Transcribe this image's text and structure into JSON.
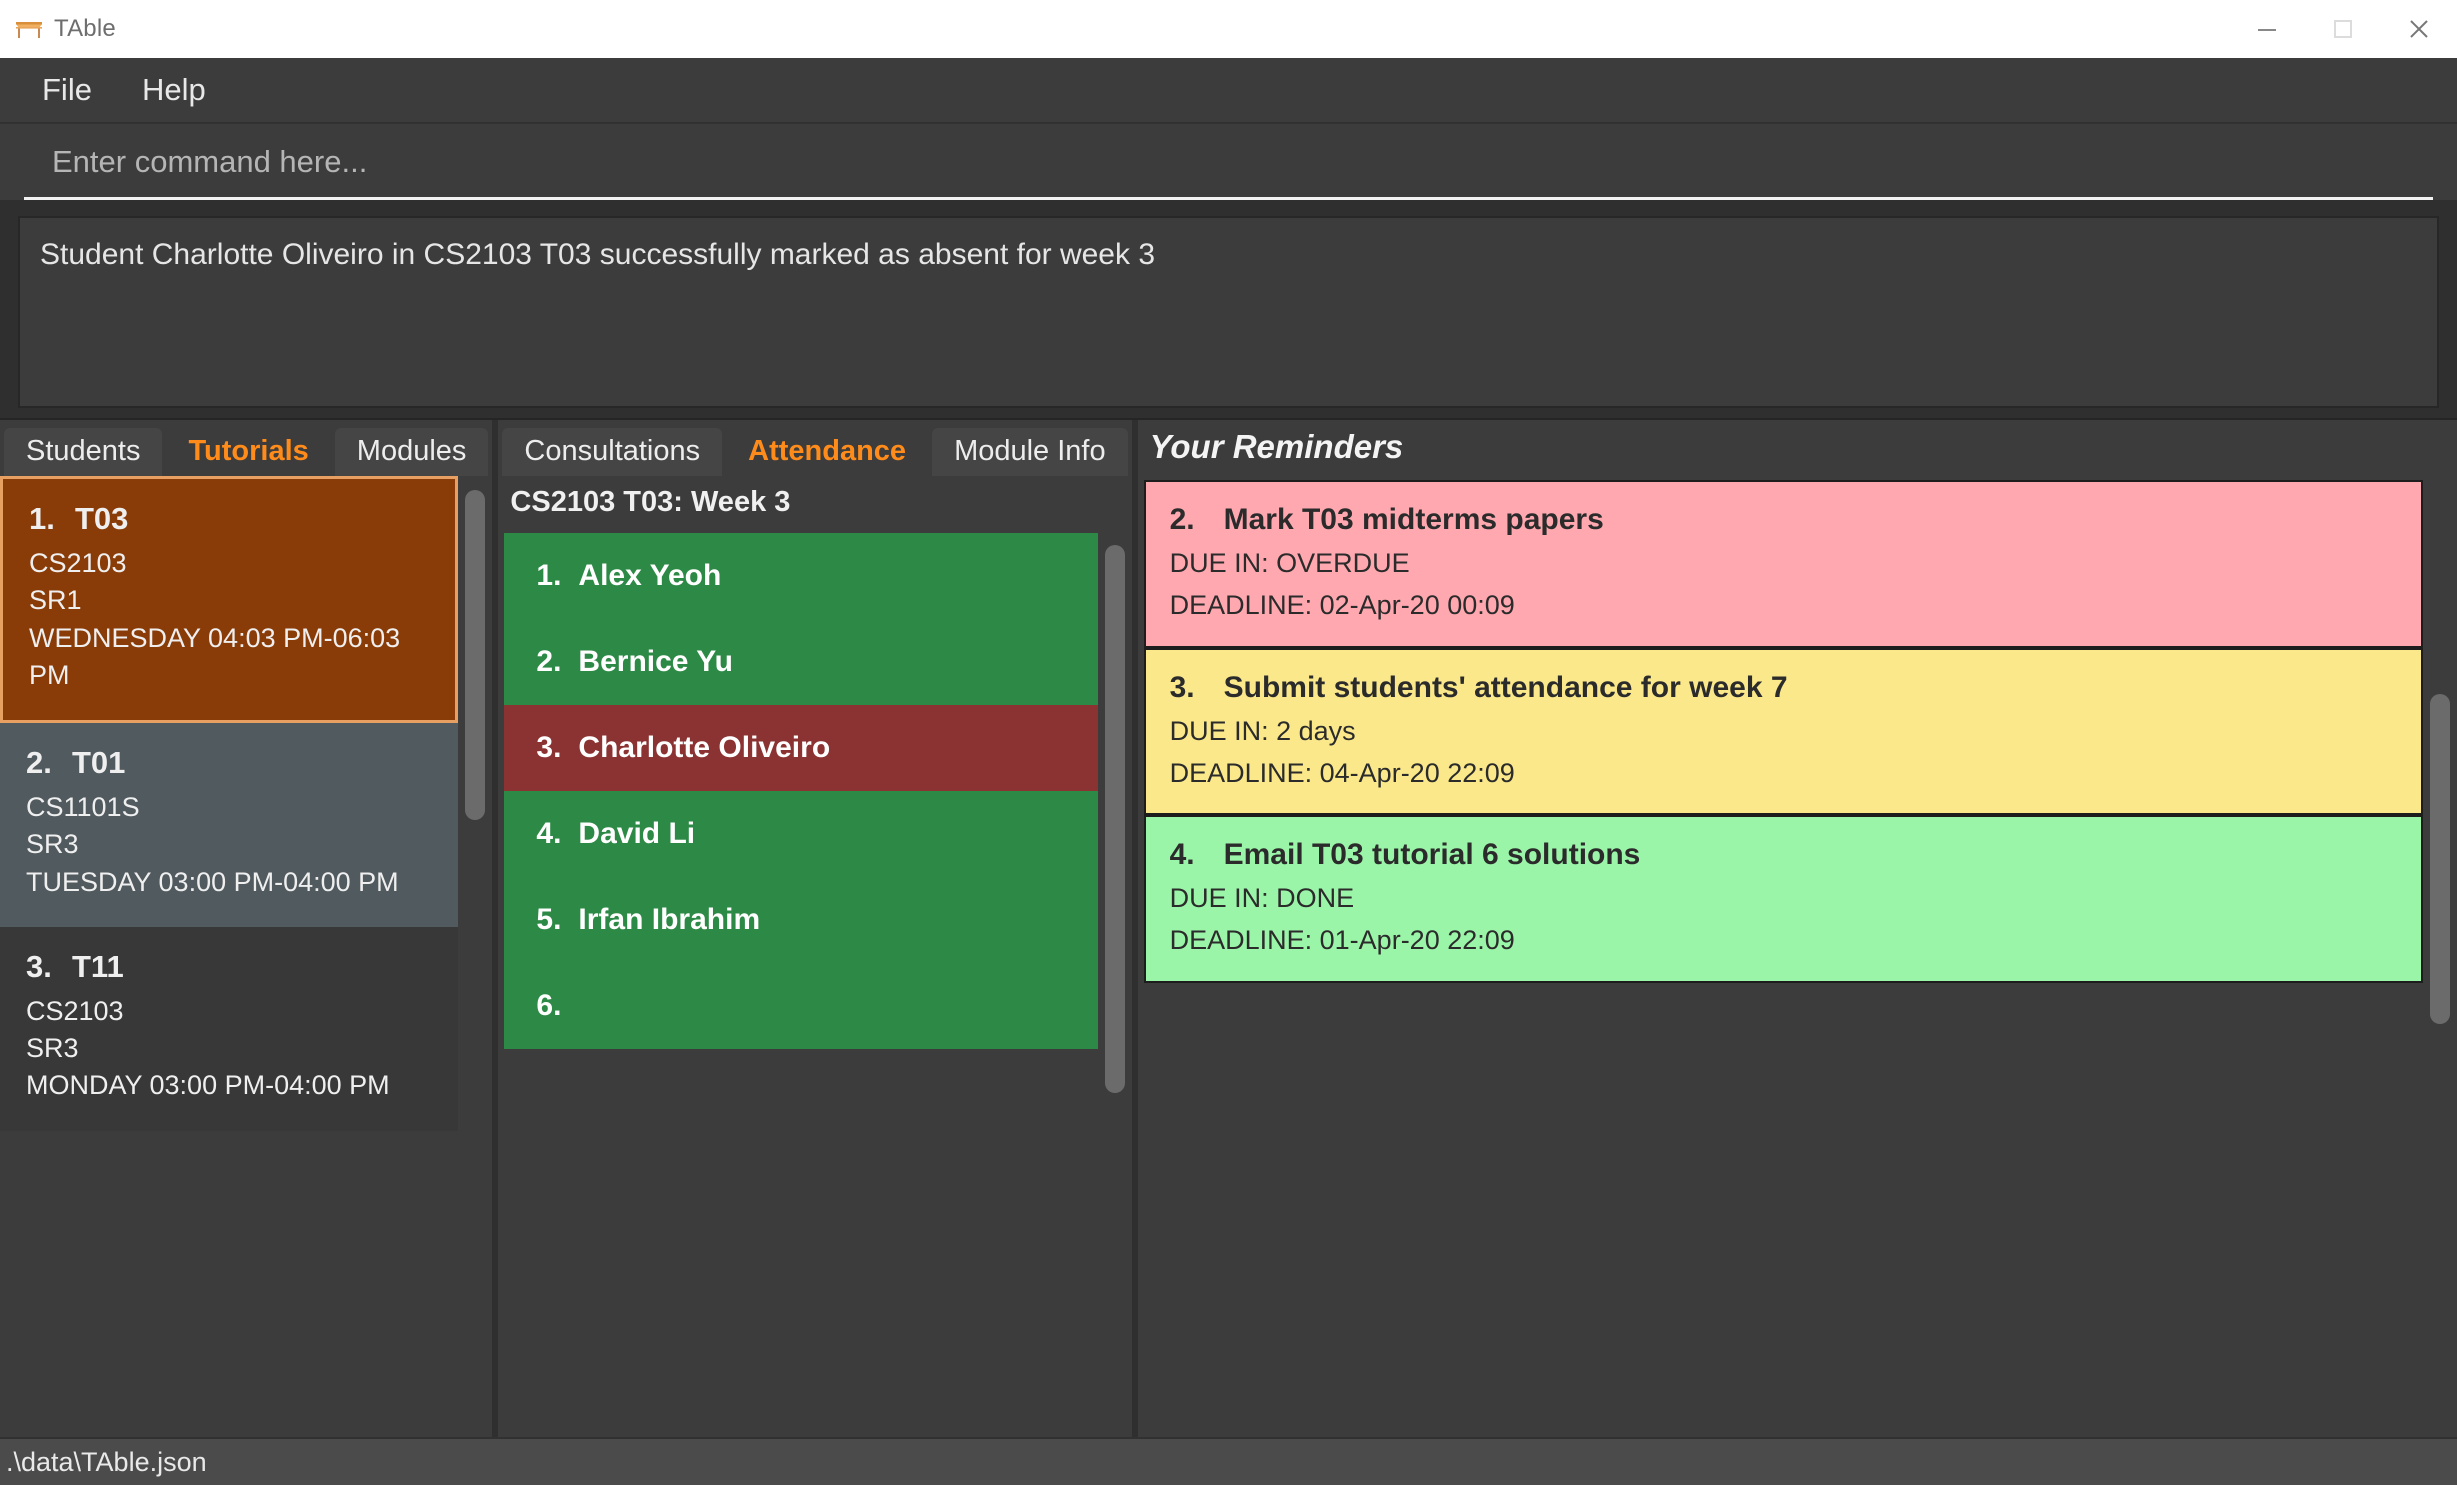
{
  "window": {
    "title": "TAble",
    "icon": "table-icon",
    "minimize_label": "—",
    "maximize_label": "□",
    "close_label": "✕"
  },
  "menubar": {
    "items": [
      {
        "label": "File"
      },
      {
        "label": "Help"
      }
    ]
  },
  "command": {
    "placeholder": "Enter command here...",
    "value": ""
  },
  "result": {
    "text": "Student Charlotte Oliveiro in CS2103 T03 successfully marked as absent for week 3"
  },
  "left_panel": {
    "tabs": [
      {
        "label": "Students",
        "active": false
      },
      {
        "label": "Tutorials",
        "active": true
      },
      {
        "label": "Modules",
        "active": false
      }
    ],
    "tutorials": [
      {
        "index": "1.",
        "name": "T03",
        "module": "CS2103",
        "venue": "SR1",
        "time": "WEDNESDAY 04:03 PM-06:03 PM",
        "state": "selected"
      },
      {
        "index": "2.",
        "name": "T01",
        "module": "CS1101S",
        "venue": "SR3",
        "time": "TUESDAY 03:00 PM-04:00 PM",
        "state": "alt"
      },
      {
        "index": "3.",
        "name": "T11",
        "module": "CS2103",
        "venue": "SR3",
        "time": "MONDAY 03:00 PM-04:00 PM",
        "state": "plain"
      }
    ]
  },
  "mid_panel": {
    "tabs": [
      {
        "label": "Consultations",
        "active": false
      },
      {
        "label": "Attendance",
        "active": true
      },
      {
        "label": "Module Info",
        "active": false
      }
    ],
    "attendance_title": "CS2103 T03: Week 3",
    "students": [
      {
        "index": "1.",
        "name": "Alex Yeoh",
        "status": "present"
      },
      {
        "index": "2.",
        "name": "Bernice Yu",
        "status": "present"
      },
      {
        "index": "3.",
        "name": "Charlotte Oliveiro",
        "status": "absent"
      },
      {
        "index": "4.",
        "name": "David Li",
        "status": "present"
      },
      {
        "index": "5.",
        "name": "Irfan Ibrahim",
        "status": "present"
      },
      {
        "index": "6.",
        "name": "",
        "status": "present"
      }
    ]
  },
  "right_panel": {
    "header": "Your Reminders",
    "reminders": [
      {
        "index": "2.",
        "name": "Mark T03 midterms papers",
        "due": "DUE IN: OVERDUE",
        "deadline": "DEADLINE: 02-Apr-20 00:09",
        "status": "overdue"
      },
      {
        "index": "3.",
        "name": "Submit students' attendance for week 7",
        "due": "DUE IN: 2 days",
        "deadline": "DEADLINE: 04-Apr-20 22:09",
        "status": "soon"
      },
      {
        "index": "4.",
        "name": "Email T03 tutorial 6 solutions",
        "due": "DUE IN: DONE",
        "deadline": "DEADLINE: 01-Apr-20 22:09",
        "status": "done"
      }
    ]
  },
  "statusbar": {
    "path": ".\\data\\TAble.json"
  },
  "colors": {
    "accent": "#ff8c1a",
    "selected_card": "#8a3c08",
    "present": "#2d8a46",
    "absent": "#8b3232",
    "overdue": "#ffa8b0",
    "soon": "#fae88a",
    "done": "#9bf5a8"
  }
}
